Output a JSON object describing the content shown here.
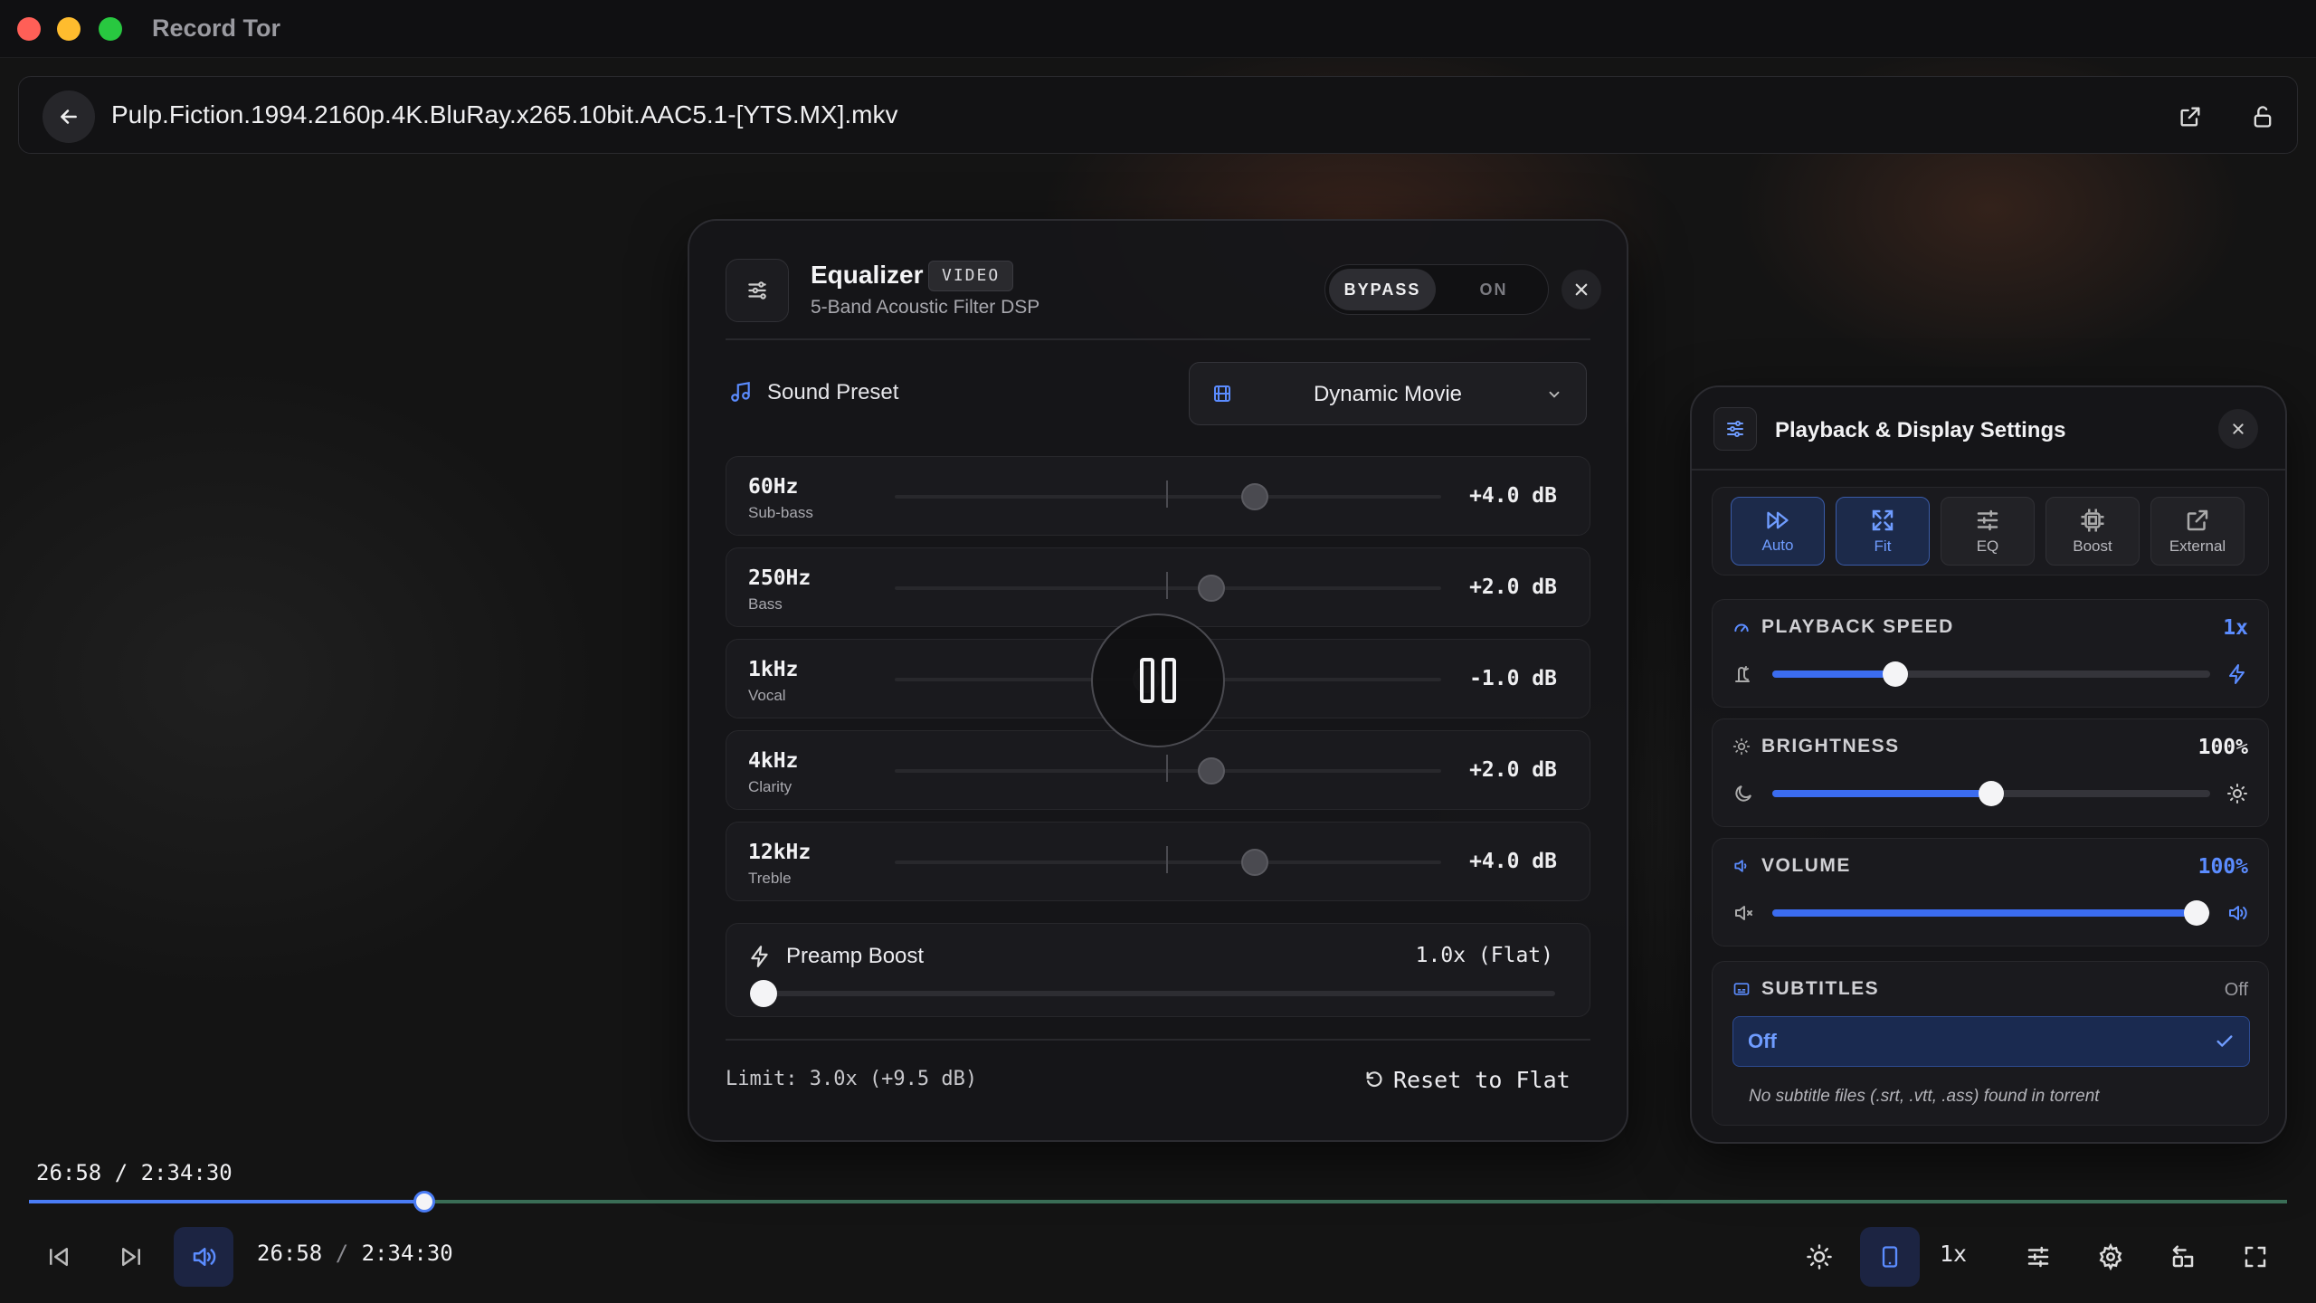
{
  "app": {
    "title": "Record Tor"
  },
  "address_bar": {
    "file_name": "Pulp.Fiction.1994.2160p.4K.BluRay.x265.10bit.AAC5.1-[YTS.MX].mkv"
  },
  "equalizer": {
    "title": "Equalizer",
    "badge": "VIDEO",
    "subtitle": "5-Band Acoustic Filter DSP",
    "bypass_label": "BYPASS",
    "on_label": "ON",
    "preset_label": "Sound Preset",
    "preset_value": "Dynamic Movie",
    "bands": [
      {
        "freq": "60Hz",
        "name": "Sub-bass",
        "value": "+4.0 dB",
        "db": 4
      },
      {
        "freq": "250Hz",
        "name": "Bass",
        "value": "+2.0 dB",
        "db": 2
      },
      {
        "freq": "1kHz",
        "name": "Vocal",
        "value": "-1.0 dB",
        "db": -1
      },
      {
        "freq": "4kHz",
        "name": "Clarity",
        "value": "+2.0 dB",
        "db": 2
      },
      {
        "freq": "12kHz",
        "name": "Treble",
        "value": "+4.0 dB",
        "db": 4
      }
    ],
    "preamp_label": "Preamp Boost",
    "preamp_value": "1.0x (Flat)",
    "limit_text": "Limit: 3.0x (+9.5 dB)",
    "reset_label": "Reset to Flat"
  },
  "playback_panel": {
    "title": "Playback & Display Settings",
    "modes": [
      {
        "label": "Auto",
        "active": true
      },
      {
        "label": "Fit",
        "active": true
      },
      {
        "label": "EQ",
        "active": false
      },
      {
        "label": "Boost",
        "active": false
      },
      {
        "label": "External",
        "active": false
      }
    ],
    "speed": {
      "label": "PLAYBACK SPEED",
      "value": "1x",
      "fraction": 0.28
    },
    "brightness": {
      "label": "BRIGHTNESS",
      "value": "100%",
      "fraction": 0.5
    },
    "volume": {
      "label": "VOLUME",
      "value": "100%",
      "fraction": 0.97
    },
    "subtitles": {
      "label": "SUBTITLES",
      "status": "Off",
      "option": "Off",
      "note": "No subtitle files (.srt, .vtt, .ass) found in torrent"
    }
  },
  "player": {
    "time_top": "26:58 / 2:34:30",
    "time_bottom_current": "26:58",
    "time_bottom_sep": "/",
    "time_bottom_total": "2:34:30",
    "progress_fraction": 0.175,
    "speed_label": "1x"
  },
  "colors": {
    "accent": "#4a7cf5",
    "seek_remaining": "#3a6d56"
  }
}
